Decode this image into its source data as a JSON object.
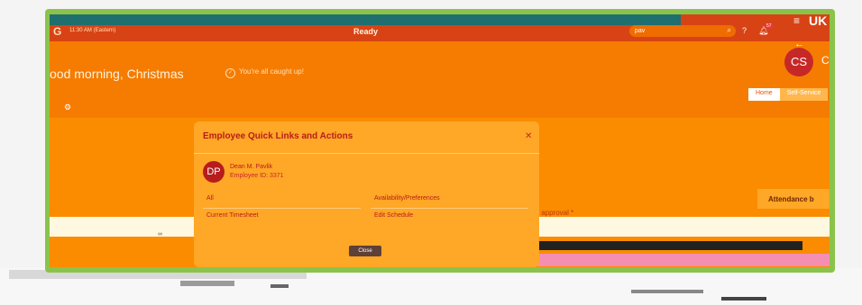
{
  "topbar": {
    "time": "11:30 AM (Eastern)",
    "status": "Ready",
    "search_value": "pav",
    "notification_count": "57",
    "brand": "UK"
  },
  "hero": {
    "greeting": "ood morning, Christmas",
    "caught_up": "You're all caught up!",
    "avatar_initials": "CS",
    "side_initial": "C",
    "tabs": [
      "Home",
      "Self-Service"
    ]
  },
  "modal": {
    "title": "Employee Quick Links and Actions",
    "employee": {
      "initials": "DP",
      "name": "Dean M. Pavlik",
      "id": "Employee ID: 3371"
    },
    "links": [
      "All",
      "Availability/Preferences",
      "Current Timesheet",
      "Edit Schedule"
    ],
    "close_label": "Close"
  },
  "attendance_label": "Attendance b",
  "awaiting_text": "Awaiting my approval *",
  "colors": {
    "frame": "#8bc34a",
    "screen": "#f57c00",
    "topbar": "#d84315",
    "modal": "#ffa726",
    "accent": "#b71c1c"
  }
}
